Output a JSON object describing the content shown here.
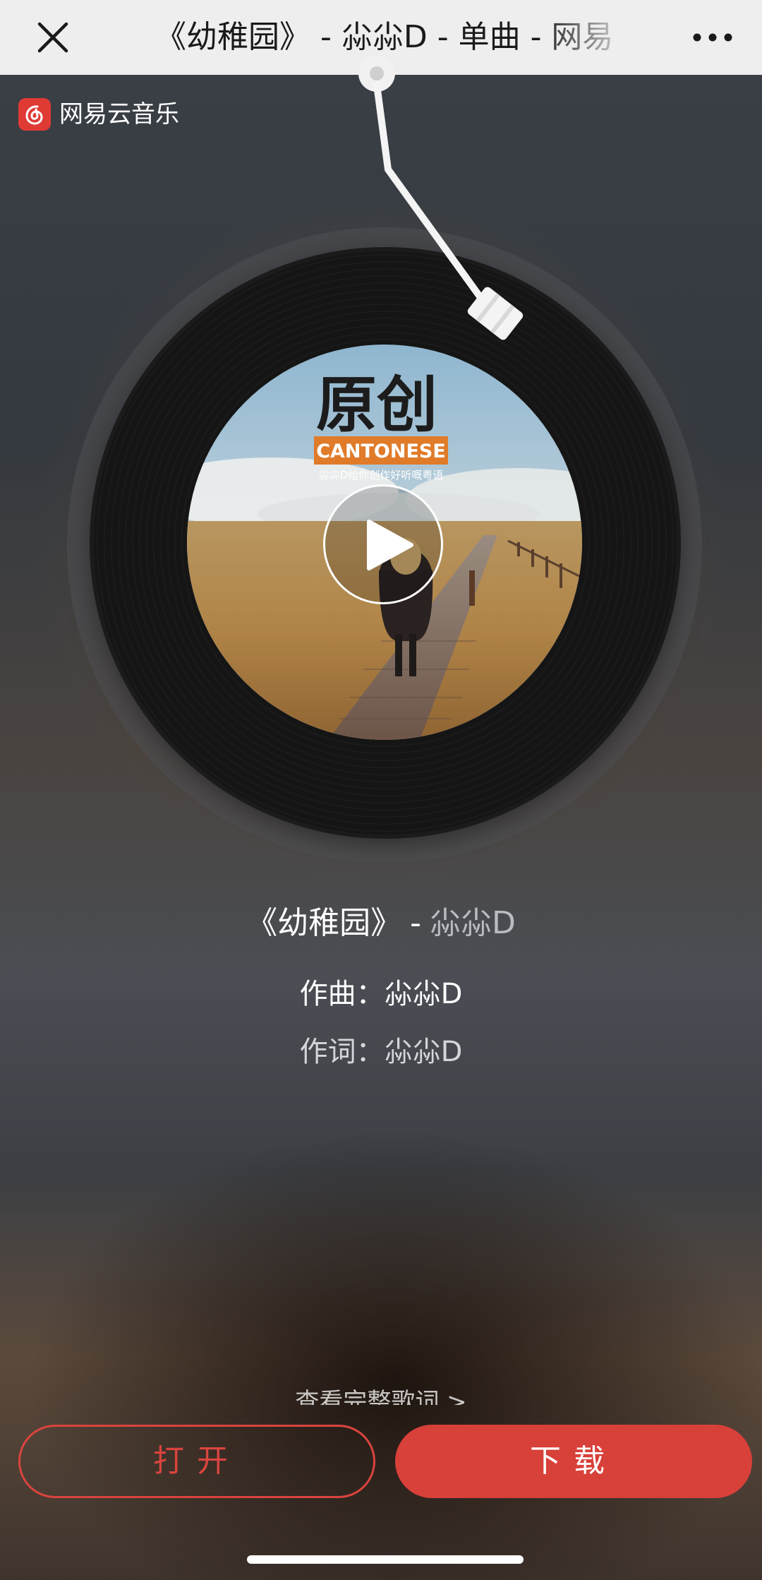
{
  "topbar": {
    "title": "《幼稚园》 - 尛尛D - 单曲 - 网易",
    "close_icon": "close-icon",
    "more_icon": "more-horizontal-icon"
  },
  "brand": {
    "name": "网易云音乐",
    "logo_icon": "netease-cloud-music-logo",
    "logo_color": "#e03a35"
  },
  "album": {
    "cover_title": "原创",
    "cover_subtitle": "CANTONESE",
    "cover_caption": "尛尛D给你创作好听嘅粤语",
    "play_icon": "play-icon"
  },
  "song": {
    "title": "《幼稚园》",
    "separator": "-",
    "artist": "尛尛D"
  },
  "credits": {
    "composer": "作曲：尛尛D",
    "lyricist": "作词：尛尛D"
  },
  "lyrics_link": "查看完整歌词 >",
  "actions": {
    "open_label": "打开",
    "download_label": "下载",
    "accent_color": "#d8403a"
  }
}
